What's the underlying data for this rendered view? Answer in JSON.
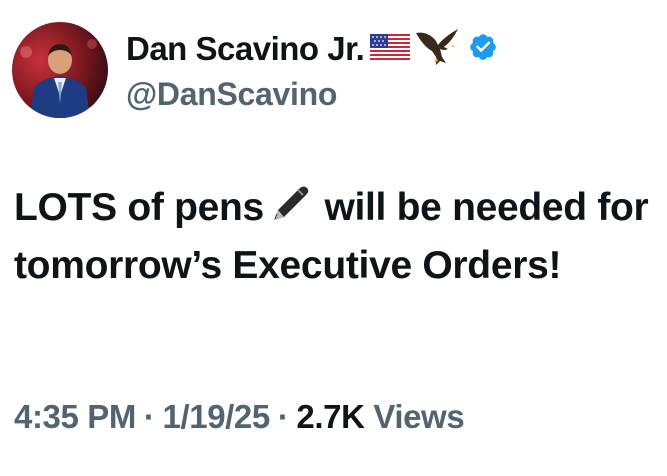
{
  "author": {
    "display_name": "Dan Scavino Jr.",
    "handle": "@DanScavino",
    "badges": [
      "us-flag-emoji",
      "eagle-emoji",
      "verified-icon"
    ],
    "verified_color": "#1d9bf0"
  },
  "tweet": {
    "text_before_pen": "LOTS of pens",
    "pen_icon": "fountain-pen-emoji",
    "text_after_pen": " will be needed for tomorrow’s Executive Orders!"
  },
  "meta": {
    "time": "4:35 PM",
    "date": "1/19/25",
    "separator": "·",
    "views_count": "2.7K",
    "views_label": "Views"
  },
  "colors": {
    "text": "#0f1419",
    "secondary": "#536471",
    "background": "#ffffff"
  }
}
